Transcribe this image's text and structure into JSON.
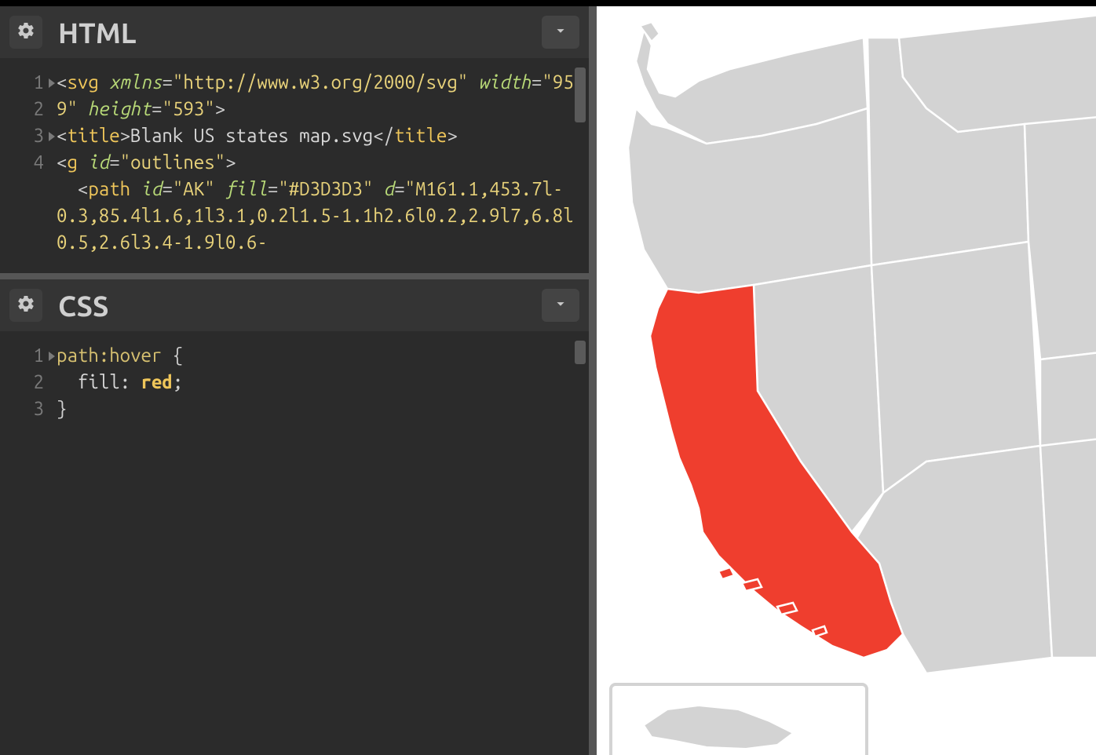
{
  "panels": {
    "html": {
      "title": "HTML"
    },
    "css": {
      "title": "CSS"
    }
  },
  "html_editor": {
    "lines": {
      "1": "1",
      "2": "2",
      "3": "3",
      "4": "4"
    },
    "code": {
      "svg_open_tag": "svg",
      "xmlns_attr": "xmlns",
      "xmlns_val": "\"http://www.w3.org/2000/svg\"",
      "width_attr": "width",
      "width_val": "\"959\"",
      "height_attr": "height",
      "height_val": "\"593\"",
      "title_tag": "title",
      "title_text": "Blank US states map.svg",
      "g_tag": "g",
      "g_id_attr": "id",
      "g_id_val": "\"outlines\"",
      "path_tag": "path",
      "path_id_attr": "id",
      "path_id_val": "\"AK\"",
      "fill_attr": "fill",
      "fill_val": "\"#D3D3D3\"",
      "d_attr": "d",
      "d_val_part": "\"M161.1,453.7l-0.3,85.4l1.6,1l3.1,0.2l1.5-1.1h2.6l0.2,2.9l7,6.8l0.5,2.6l3.4-1.9l0.6-"
    }
  },
  "css_editor": {
    "lines": {
      "1": "1",
      "2": "2",
      "3": "3"
    },
    "code": {
      "selector": "path",
      "pseudo": ":hover",
      "open_brace": " {",
      "prop_indent": "  ",
      "prop": "fill",
      "colon": ": ",
      "value": "red",
      "semicolon": ";",
      "close_brace": "}"
    }
  },
  "preview": {
    "default_fill": "#D3D3D3",
    "hover_fill": "#EF3E2E",
    "hovered_state": "CA"
  }
}
